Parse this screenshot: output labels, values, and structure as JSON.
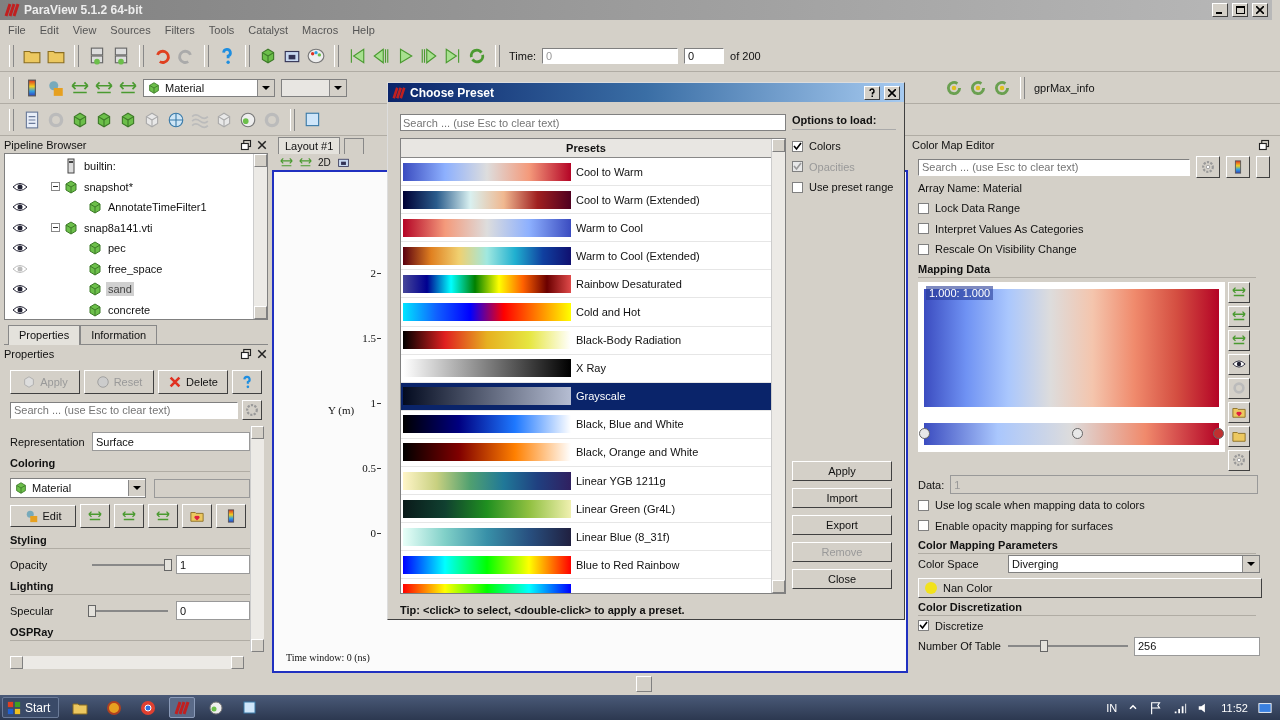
{
  "window": {
    "title": "ParaView 5.1.2 64-bit"
  },
  "menu": [
    "File",
    "Edit",
    "View",
    "Sources",
    "Filters",
    "Tools",
    "Catalyst",
    "Macros",
    "Help"
  ],
  "toolbar": {
    "time_label": "Time:",
    "time_value": "0",
    "timestep": "0",
    "timestep_total": "of 200",
    "color_array": "Material",
    "view_info": "gprMax_info"
  },
  "pipeline_browser": {
    "title": "Pipeline Browser",
    "items": [
      {
        "label": "builtin:",
        "selected": false,
        "children": [
          {
            "label": "snapshot*",
            "visible": true,
            "expanded": true,
            "selected": false,
            "children": [
              {
                "label": "AnnotateTimeFilter1",
                "visible": true,
                "selected": false
              }
            ]
          },
          {
            "label": "snap8a141.vti",
            "visible": true,
            "expanded": true,
            "selected": false,
            "children": [
              {
                "label": "pec",
                "visible": true,
                "selected": false
              },
              {
                "label": "free_space",
                "visible": false,
                "selected": false
              },
              {
                "label": "sand",
                "visible": true,
                "selected": true
              },
              {
                "label": "concrete",
                "visible": true,
                "selected": false
              }
            ]
          }
        ]
      }
    ]
  },
  "panel_tabs": [
    {
      "label": "Properties",
      "selected": true
    },
    {
      "label": "Information",
      "selected": false
    }
  ],
  "properties": {
    "title": "Properties",
    "buttons": [
      {
        "label": "Apply",
        "kind": "apply",
        "disabled": true
      },
      {
        "label": "Reset",
        "kind": "reset",
        "disabled": true
      },
      {
        "label": "Delete",
        "kind": "delete",
        "disabled": false
      }
    ],
    "search_placeholder": "Search ... (use Esc to clear text)",
    "representation_label": "Representation",
    "representation": "Surface",
    "coloring_title": "Coloring",
    "coloring_array": "Material",
    "edit_button": "Edit",
    "styling_title": "Styling",
    "opacity": {
      "label": "Opacity",
      "level": 1,
      "value": "1"
    },
    "lighting_title": "Lighting",
    "specular": {
      "label": "Specular",
      "level": 0,
      "value": "0"
    },
    "ospray_title": "OSPRay"
  },
  "view": {
    "tab": "Layout #1",
    "toolbar_mode": "2D",
    "y_label": "Y (m)",
    "y_ticks": [
      "2",
      "1.5",
      "1",
      "0.5",
      "0"
    ],
    "caption": "Time window: 0 (ns)"
  },
  "dialog": {
    "title": "Choose Preset",
    "search_placeholder": "Search ... (use Esc to clear text)",
    "column": "Presets",
    "presets": [
      {
        "name": "Cool to Warm",
        "selected": false
      },
      {
        "name": "Cool to Warm (Extended)",
        "selected": false
      },
      {
        "name": "Warm to Cool",
        "selected": false
      },
      {
        "name": "Warm to Cool (Extended)",
        "selected": false
      },
      {
        "name": "Rainbow Desaturated",
        "selected": false
      },
      {
        "name": "Cold and Hot",
        "selected": false
      },
      {
        "name": "Black-Body Radiation",
        "selected": false
      },
      {
        "name": "X Ray",
        "selected": false
      },
      {
        "name": "Grayscale",
        "selected": true
      },
      {
        "name": "Black, Blue and White",
        "selected": false
      },
      {
        "name": "Black, Orange and White",
        "selected": false
      },
      {
        "name": "Linear YGB 1211g",
        "selected": false
      },
      {
        "name": "Linear Green (Gr4L)",
        "selected": false
      },
      {
        "name": "Linear Blue (8_31f)",
        "selected": false
      },
      {
        "name": "Blue to Red Rainbow",
        "selected": false
      },
      {
        "selected": false
      }
    ],
    "options_title": "Options to load:",
    "options": [
      {
        "label": "Colors",
        "checked": true,
        "disabled": false
      },
      {
        "label": "Opacities",
        "checked": true,
        "disabled": true
      },
      {
        "label": "Use preset range",
        "checked": false,
        "disabled": false
      }
    ],
    "buttons": [
      {
        "label": "Apply",
        "disabled": false
      },
      {
        "label": "Import",
        "disabled": false
      },
      {
        "label": "Export",
        "disabled": false
      },
      {
        "label": "Remove",
        "disabled": true
      },
      {
        "label": "Close",
        "disabled": false
      }
    ],
    "tip": "Tip: <click> to select, <double-click> to apply a preset."
  },
  "color_map_editor": {
    "title": "Color Map Editor",
    "search_placeholder": "Search ... (use Esc to clear text)",
    "array_name": "Array Name: Material",
    "options": [
      {
        "label": "Lock Data Range",
        "checked": false
      },
      {
        "label": "Interpret Values As Categories",
        "checked": false
      },
      {
        "label": "Rescale On Visibility Change",
        "checked": false
      }
    ],
    "mapping_title": "Mapping Data",
    "range_label": "1.000: 1.000",
    "data_label": "Data:",
    "data_value": "1",
    "mapping_options": [
      {
        "label": "Use log scale when mapping data to colors",
        "checked": false
      },
      {
        "label": "Enable opacity mapping for surfaces",
        "checked": false
      }
    ],
    "parameters_title": "Color Mapping Parameters",
    "color_space_label": "Color Space",
    "color_space": "Diverging",
    "nan_color": {
      "label": "Nan Color",
      "color": "#f2e21c"
    },
    "discretization_title": "Color Discretization",
    "discretize": {
      "label": "Discretize",
      "checked": true
    },
    "table_values": {
      "label": "Number Of Table",
      "level": 0.3,
      "value": "256"
    }
  },
  "taskbar": {
    "start": "Start",
    "language": "IN",
    "time": "11:52"
  }
}
